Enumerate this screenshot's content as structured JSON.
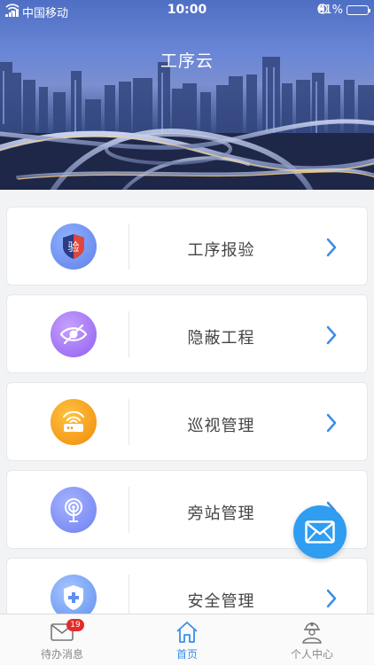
{
  "status_bar": {
    "carrier": "中国移动",
    "time": "10:00",
    "battery_percent": "81%",
    "battery_level": 0.81
  },
  "header": {
    "title": "工序云"
  },
  "menu": {
    "items": [
      {
        "label": "工序报验",
        "icon": "inspection-shield-icon",
        "icon_text": "验",
        "color": "#6f8ff0"
      },
      {
        "label": "隐蔽工程",
        "icon": "hidden-eye-icon",
        "color": "#9b6ff0"
      },
      {
        "label": "巡视管理",
        "icon": "router-signal-icon",
        "color": "#f6a21a"
      },
      {
        "label": "旁站管理",
        "icon": "antenna-icon",
        "color": "#6c7ff0"
      },
      {
        "label": "安全管理",
        "icon": "safety-shield-icon",
        "color": "#6a9cf5"
      }
    ]
  },
  "tabbar": {
    "tabs": [
      {
        "label": "待办消息",
        "badge": "19",
        "icon": "mail-icon"
      },
      {
        "label": "首页",
        "icon": "home-icon",
        "active": true
      },
      {
        "label": "个人中心",
        "icon": "worker-icon"
      }
    ]
  },
  "colors": {
    "accent": "#3a8ee6",
    "fab": "#2f9df0",
    "chevron": "#3a8ee6",
    "badge": "#e52b2b"
  }
}
